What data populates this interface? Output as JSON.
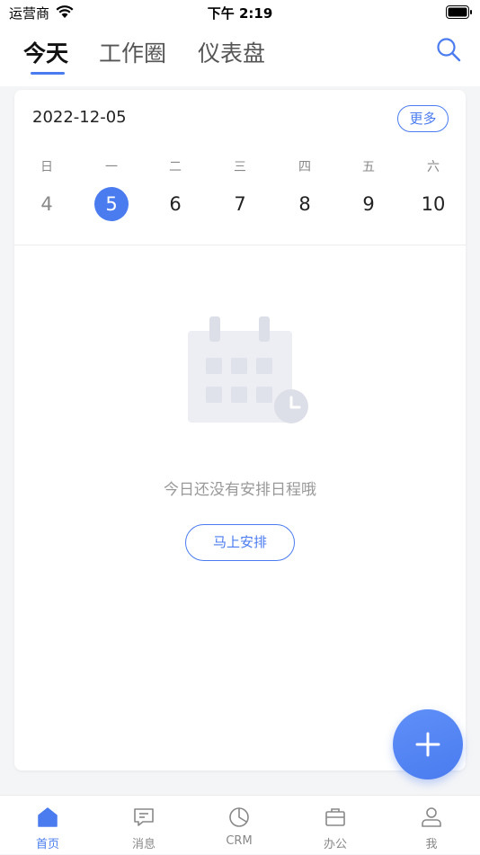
{
  "status_bar": {
    "carrier": "运营商",
    "time": "下午 2:19"
  },
  "header": {
    "tabs": [
      {
        "label": "今天",
        "active": true
      },
      {
        "label": "工作圈",
        "active": false
      },
      {
        "label": "仪表盘",
        "active": false
      }
    ]
  },
  "calendar": {
    "date": "2022-12-05",
    "more_label": "更多",
    "weekdays": [
      "日",
      "一",
      "二",
      "三",
      "四",
      "五",
      "六"
    ],
    "days": [
      "4",
      "5",
      "6",
      "7",
      "8",
      "9",
      "10"
    ],
    "selected_day": "5"
  },
  "empty_state": {
    "message": "今日还没有安排日程哦",
    "button_label": "马上安排"
  },
  "tabbar": {
    "items": [
      {
        "label": "首页",
        "icon": "home-icon",
        "active": true
      },
      {
        "label": "消息",
        "icon": "message-icon",
        "active": false
      },
      {
        "label": "CRM",
        "icon": "pie-chart-icon",
        "active": false
      },
      {
        "label": "办公",
        "icon": "briefcase-icon",
        "active": false
      },
      {
        "label": "我",
        "icon": "user-icon",
        "active": false
      }
    ]
  },
  "colors": {
    "accent": "#4a7cf0",
    "muted_text": "#888888",
    "background": "#f4f5f7"
  }
}
